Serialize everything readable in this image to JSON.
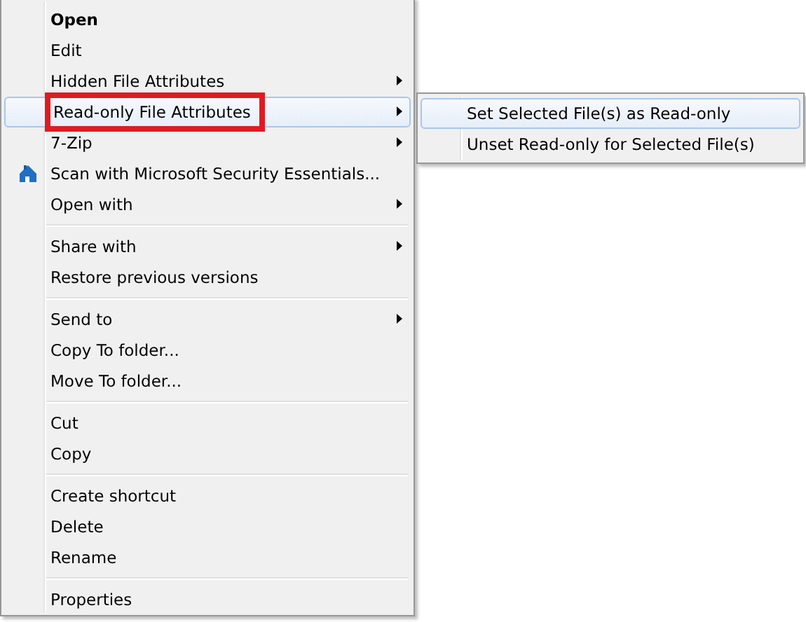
{
  "context_menu": {
    "groups": [
      [
        {
          "label": "Open",
          "bold": true,
          "submenu": false,
          "selected": false
        },
        {
          "label": "Edit",
          "bold": false,
          "submenu": false,
          "selected": false
        },
        {
          "label": "Hidden File Attributes",
          "bold": false,
          "submenu": true,
          "selected": false
        },
        {
          "label": "Read-only File Attributes",
          "bold": false,
          "submenu": true,
          "selected": true,
          "annotated": true
        },
        {
          "label": "7-Zip",
          "bold": false,
          "submenu": true,
          "selected": false
        },
        {
          "label": "Scan with Microsoft Security Essentials...",
          "bold": false,
          "submenu": false,
          "selected": false,
          "kind": "icon"
        },
        {
          "label": "Open with",
          "bold": false,
          "submenu": true,
          "selected": false
        }
      ],
      [
        {
          "label": "Share with",
          "bold": false,
          "submenu": true,
          "selected": false
        },
        {
          "label": "Restore previous versions",
          "bold": false,
          "submenu": false,
          "selected": false
        }
      ],
      [
        {
          "label": "Send to",
          "bold": false,
          "submenu": true,
          "selected": false
        },
        {
          "label": "Copy To folder...",
          "bold": false,
          "submenu": false,
          "selected": false
        },
        {
          "label": "Move To folder...",
          "bold": false,
          "submenu": false,
          "selected": false
        }
      ],
      [
        {
          "label": "Cut",
          "bold": false,
          "submenu": false,
          "selected": false
        },
        {
          "label": "Copy",
          "bold": false,
          "submenu": false,
          "selected": false
        }
      ],
      [
        {
          "label": "Create shortcut",
          "bold": false,
          "submenu": false,
          "selected": false
        },
        {
          "label": "Delete",
          "bold": false,
          "submenu": false,
          "selected": false
        },
        {
          "label": "Rename",
          "bold": false,
          "submenu": false,
          "selected": false
        }
      ],
      [
        {
          "label": "Properties",
          "bold": false,
          "submenu": false,
          "selected": false
        }
      ]
    ]
  },
  "submenu": {
    "items": [
      {
        "label": "Set Selected File(s) as Read-only",
        "selected": true
      },
      {
        "label": "Unset Read-only for Selected File(s)",
        "selected": false
      }
    ]
  }
}
